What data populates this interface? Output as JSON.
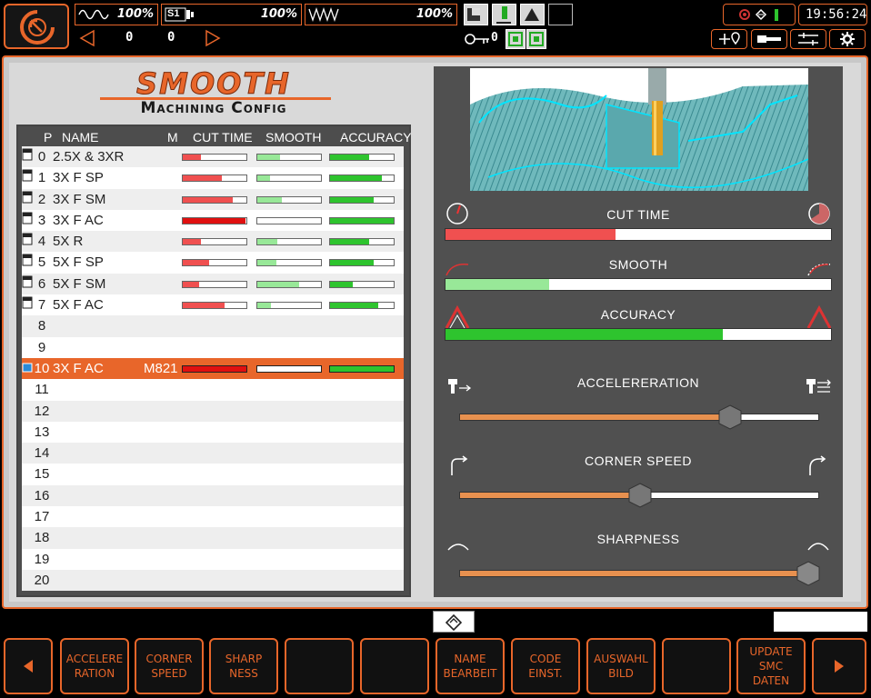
{
  "topbar": {
    "meters": [
      {
        "icon": "spindle-wave-icon",
        "value": "100%"
      },
      {
        "icon": "s1-spindle-icon",
        "label": "S1",
        "value": "100%"
      },
      {
        "icon": "feed-wave-icon",
        "value": "100%"
      }
    ],
    "counter_left": "0",
    "counter_right": "0",
    "tool_counter": "0",
    "clock": "19:56:24"
  },
  "title": {
    "main": "SMOOTH",
    "sub": "Machining Config"
  },
  "table": {
    "headers": {
      "p": "P",
      "name": "NAME",
      "m": "M",
      "cut_time": "CUT TIME",
      "smooth": "SMOOTH",
      "accuracy": "ACCURACY"
    },
    "rows": [
      {
        "p": "0",
        "name": "2.5X & 3XR",
        "m": "",
        "cut": 0.28,
        "smooth": 0.35,
        "acc": 0.62,
        "icon": true
      },
      {
        "p": "1",
        "name": "3X F SP",
        "m": "",
        "cut": 0.62,
        "smooth": 0.2,
        "acc": 0.82,
        "icon": true
      },
      {
        "p": "2",
        "name": "3X F SM",
        "m": "",
        "cut": 0.78,
        "smooth": 0.38,
        "acc": 0.68,
        "icon": true
      },
      {
        "p": "3",
        "name": "3X F AC",
        "m": "",
        "cut": 0.98,
        "smooth": 0.0,
        "acc": 1.0,
        "icon": true
      },
      {
        "p": "4",
        "name": "5X R",
        "m": "",
        "cut": 0.28,
        "smooth": 0.32,
        "acc": 0.62,
        "icon": true
      },
      {
        "p": "5",
        "name": "5X F SP",
        "m": "",
        "cut": 0.42,
        "smooth": 0.3,
        "acc": 0.68,
        "icon": true
      },
      {
        "p": "6",
        "name": "5X F SM",
        "m": "",
        "cut": 0.25,
        "smooth": 0.65,
        "acc": 0.35,
        "icon": true
      },
      {
        "p": "7",
        "name": "5X F AC",
        "m": "",
        "cut": 0.65,
        "smooth": 0.22,
        "acc": 0.75,
        "icon": true
      },
      {
        "p": "8",
        "name": "",
        "m": ""
      },
      {
        "p": "9",
        "name": "",
        "m": ""
      },
      {
        "p": "10",
        "name": "3X F AC",
        "m": "M821",
        "cut": 1.0,
        "smooth": 0.0,
        "acc": 1.0,
        "selected": true
      },
      {
        "p": "11",
        "name": "",
        "m": ""
      },
      {
        "p": "12",
        "name": "",
        "m": ""
      },
      {
        "p": "13",
        "name": "",
        "m": ""
      },
      {
        "p": "14",
        "name": "",
        "m": ""
      },
      {
        "p": "15",
        "name": "",
        "m": ""
      },
      {
        "p": "16",
        "name": "",
        "m": ""
      },
      {
        "p": "17",
        "name": "",
        "m": ""
      },
      {
        "p": "18",
        "name": "",
        "m": ""
      },
      {
        "p": "19",
        "name": "",
        "m": ""
      },
      {
        "p": "20",
        "name": "",
        "m": ""
      }
    ]
  },
  "panel": {
    "cut_time": {
      "label": "CUT TIME",
      "value": 0.44
    },
    "smooth": {
      "label": "SMOOTH",
      "value": 0.27
    },
    "accuracy": {
      "label": "ACCURACY",
      "value": 0.72
    },
    "acceleration": {
      "label": "ACCELERERATION",
      "value": 0.75
    },
    "corner_speed": {
      "label": "CORNER SPEED",
      "value": 0.5
    },
    "sharpness": {
      "label": "SHARPNESS",
      "value": 1.0
    }
  },
  "colors": {
    "accent": "#e8662a",
    "cut_red": "#f05050",
    "selected_red": "#e01010",
    "smooth_light_green": "#98e898",
    "accuracy_green": "#2ec42e",
    "slider_orange": "#e8914f"
  },
  "softkeys": [
    {
      "label": "",
      "icon": "left-arrow-icon"
    },
    {
      "label": "ACCELERE\nRATION"
    },
    {
      "label": "CORNER\nSPEED"
    },
    {
      "label": "SHARP\nNESS"
    },
    {
      "label": ""
    },
    {
      "label": ""
    },
    {
      "label": "NAME\nBEARBEIT"
    },
    {
      "label": "CODE\nEINST."
    },
    {
      "label": "AUSWAHL\nBILD"
    },
    {
      "label": ""
    },
    {
      "label": "UPDATE\nSMC\nDATEN"
    },
    {
      "label": "",
      "icon": "right-arrow-icon"
    }
  ]
}
